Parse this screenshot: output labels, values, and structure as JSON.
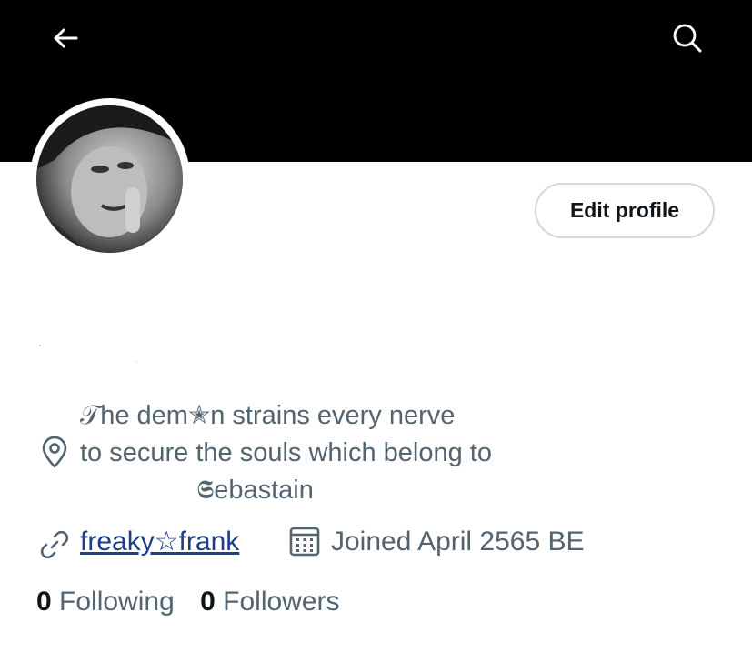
{
  "header": {
    "back_icon": "arrow-left-icon",
    "search_icon": "search-icon",
    "banner_color": "#000000"
  },
  "profile": {
    "avatar_alt": "profile photo",
    "edit_button_label": "Edit profile",
    "bio_lines": [
      "𝒯he dem✭n strains every nerve",
      "to secure the souls which belong to",
      "𝕾ebastain"
    ],
    "link_text": "freaky☆frank",
    "joined_text": "Joined April 2565 BE"
  },
  "stats": {
    "following_count": "0",
    "following_label": "Following",
    "followers_count": "0",
    "followers_label": "Followers"
  },
  "colors": {
    "text_primary": "#0f1419",
    "text_secondary": "#536471",
    "link": "#1d3f8a",
    "border": "#cfd9de"
  }
}
